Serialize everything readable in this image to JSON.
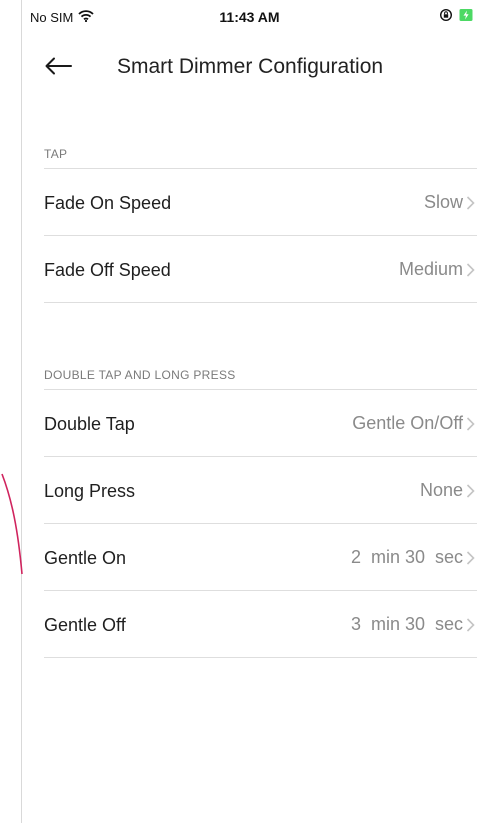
{
  "status_bar": {
    "carrier": "No SIM",
    "time": "11:43 AM",
    "wifi_icon": "wifi-icon",
    "lock_icon": "orientation-lock-icon",
    "battery_icon": "battery-charging-icon"
  },
  "nav": {
    "back_icon": "arrow-left-icon",
    "title": "Smart Dimmer Configuration"
  },
  "sections": {
    "tap": {
      "header": "TAP",
      "rows": [
        {
          "label": "Fade On Speed",
          "value": "Slow"
        },
        {
          "label": "Fade Off Speed",
          "value": "Medium"
        }
      ]
    },
    "double_tap": {
      "header": "DOUBLE TAP AND LONG PRESS",
      "rows": [
        {
          "label": "Double Tap",
          "value": "Gentle On/Off"
        },
        {
          "label": "Long Press",
          "value": "None"
        },
        {
          "label": "Gentle On",
          "value": "2  min 30  sec"
        },
        {
          "label": "Gentle Off",
          "value": "3  min 30  sec"
        }
      ]
    }
  },
  "colors": {
    "accent_curve": "#d0245e",
    "chevron": "#c4c4c4",
    "value_text": "#8a8a8a",
    "divider": "#dedede",
    "battery": "#4cd964"
  }
}
